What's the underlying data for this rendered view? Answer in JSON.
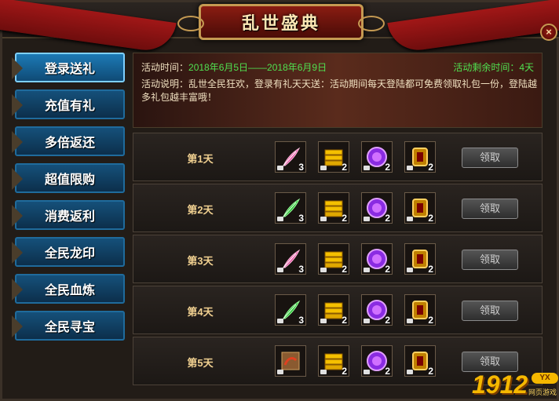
{
  "header": {
    "title": "乱世盛典",
    "close_label": "×"
  },
  "sidebar": {
    "items": [
      {
        "label": "登录送礼",
        "active": true
      },
      {
        "label": "充值有礼",
        "active": false
      },
      {
        "label": "多倍返还",
        "active": false
      },
      {
        "label": "超值限购",
        "active": false
      },
      {
        "label": "消费返利",
        "active": false
      },
      {
        "label": "全民龙印",
        "active": false
      },
      {
        "label": "全民血炼",
        "active": false
      },
      {
        "label": "全民寻宝",
        "active": false
      }
    ]
  },
  "info": {
    "time_label": "活动时间：",
    "time_value": "2018年6月5日——2018年6月9日",
    "remaining_label": "活动剩余时间：4天",
    "desc": "活动说明：乱世全民狂欢，登录有礼天天送：活动期间每天登陆都可免费领取礼包一份，登陆越多礼包越丰富哦！"
  },
  "rewards": [
    {
      "day": "第1天",
      "items": [
        {
          "icon": "pink-feather-icon",
          "count": "3"
        },
        {
          "icon": "gold-bars-icon",
          "count": "2"
        },
        {
          "icon": "purple-orb-icon",
          "count": "2"
        },
        {
          "icon": "gold-seal-icon",
          "count": "2"
        }
      ],
      "button": "领取"
    },
    {
      "day": "第2天",
      "items": [
        {
          "icon": "green-feather-icon",
          "count": "3"
        },
        {
          "icon": "gold-bars-icon",
          "count": "2"
        },
        {
          "icon": "purple-orb-icon",
          "count": "2"
        },
        {
          "icon": "gold-seal-icon",
          "count": "2"
        }
      ],
      "button": "领取"
    },
    {
      "day": "第3天",
      "items": [
        {
          "icon": "pink-feather-icon",
          "count": "3"
        },
        {
          "icon": "gold-bars-icon",
          "count": "2"
        },
        {
          "icon": "purple-orb-icon",
          "count": "2"
        },
        {
          "icon": "gold-seal-icon",
          "count": "2"
        }
      ],
      "button": "领取"
    },
    {
      "day": "第4天",
      "items": [
        {
          "icon": "green-feather-icon",
          "count": "3"
        },
        {
          "icon": "gold-bars-icon",
          "count": "2"
        },
        {
          "icon": "purple-orb-icon",
          "count": "2"
        },
        {
          "icon": "gold-seal-icon",
          "count": "2"
        }
      ],
      "button": "领取"
    },
    {
      "day": "第5天",
      "items": [
        {
          "icon": "scroll-book-icon",
          "count": ""
        },
        {
          "icon": "gold-bars-icon",
          "count": "2"
        },
        {
          "icon": "purple-orb-icon",
          "count": "2"
        },
        {
          "icon": "gold-seal-icon",
          "count": "2"
        }
      ],
      "button": "领取"
    }
  ],
  "watermark": {
    "number": "1912",
    "badge": "YX",
    "subtext": "网页游戏"
  }
}
